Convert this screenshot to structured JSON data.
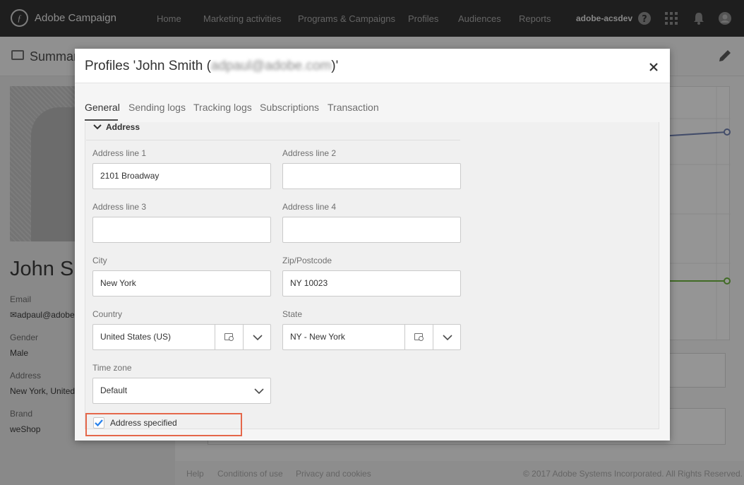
{
  "app": {
    "title": "Adobe Campaign",
    "nav": [
      "Home",
      "Marketing activities",
      "Programs & Campaigns",
      "Profiles",
      "Audiences",
      "Reports"
    ],
    "user": "adobe-acsdev",
    "icons": [
      "help-icon",
      "apps-icon",
      "notifications-icon",
      "user-avatar-icon"
    ]
  },
  "background": {
    "page_title": "Summar",
    "profile_name": "John Sm",
    "fields": [
      {
        "label": "Email",
        "value": "adpaul@adobe"
      },
      {
        "label": "Gender",
        "value": "Male"
      },
      {
        "label": "Address",
        "value": "New York, United"
      },
      {
        "label": "Brand",
        "value": "weShop"
      }
    ],
    "footer": {
      "links": [
        "Help",
        "Conditions of use",
        "Privacy and cookies"
      ],
      "copyright": "© 2017 Adobe Systems Incorporated. All Rights Reserved."
    }
  },
  "modal": {
    "title_prefix": "Profiles 'John Smith (",
    "title_email": "adpaul@adobe.com",
    "title_suffix": ")'",
    "close_label": "×",
    "tabs": [
      "General",
      "Sending logs",
      "Tracking logs",
      "Subscriptions",
      "Transaction"
    ],
    "active_tab": "General",
    "section": {
      "title": "Address",
      "fields": {
        "address1": {
          "label": "Address line 1",
          "value": "2101 Broadway"
        },
        "address2": {
          "label": "Address line 2",
          "value": ""
        },
        "address3": {
          "label": "Address line 3",
          "value": ""
        },
        "address4": {
          "label": "Address line 4",
          "value": ""
        },
        "city": {
          "label": "City",
          "value": "New York"
        },
        "zip": {
          "label": "Zip/Postcode",
          "value": "NY 10023"
        },
        "country": {
          "label": "Country",
          "value": "United States (US)"
        },
        "state": {
          "label": "State",
          "value": "NY - New York"
        },
        "timezone": {
          "label": "Time zone",
          "value": "Default"
        }
      },
      "checkbox": {
        "label": "Address specified",
        "checked": true
      }
    }
  },
  "colors": {
    "topbar": "#323232",
    "checkbox_blue": "#2680eb",
    "highlight": "#e5674a",
    "chart_line_blue": "#6f7fb0",
    "chart_line_green": "#6db33f"
  }
}
